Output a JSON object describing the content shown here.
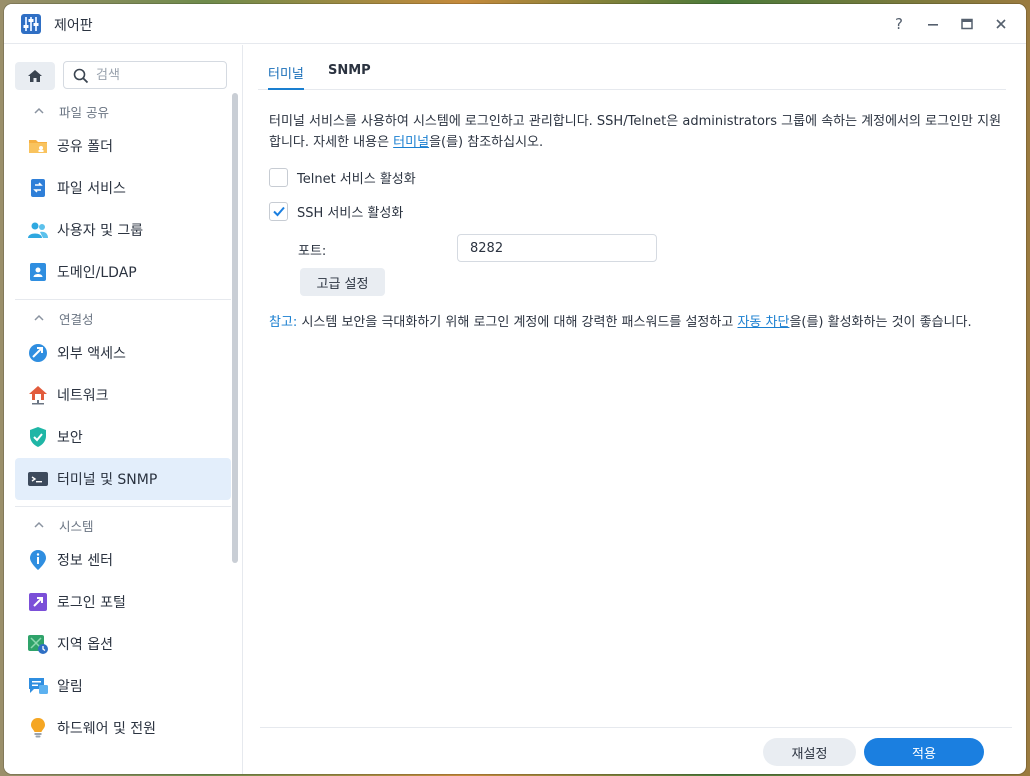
{
  "window": {
    "title": "제어판",
    "controls": {
      "help": "?",
      "minimize": "—",
      "maximize": "▭",
      "close": "✕"
    }
  },
  "sidebar": {
    "search_placeholder": "검색",
    "sections": [
      {
        "label": "파일 공유",
        "items": [
          {
            "label": "공유 폴더",
            "icon": "shared-folder-icon"
          },
          {
            "label": "파일 서비스",
            "icon": "file-services-icon"
          },
          {
            "label": "사용자 및 그룹",
            "icon": "users-groups-icon"
          },
          {
            "label": "도메인/LDAP",
            "icon": "domain-ldap-icon"
          }
        ]
      },
      {
        "label": "연결성",
        "items": [
          {
            "label": "외부 액세스",
            "icon": "external-access-icon"
          },
          {
            "label": "네트워크",
            "icon": "network-icon"
          },
          {
            "label": "보안",
            "icon": "security-shield-icon"
          },
          {
            "label": "터미널 및 SNMP",
            "icon": "terminal-icon",
            "active": true
          }
        ]
      },
      {
        "label": "시스템",
        "items": [
          {
            "label": "정보 센터",
            "icon": "info-center-icon"
          },
          {
            "label": "로그인 포털",
            "icon": "login-portal-icon"
          },
          {
            "label": "지역 옵션",
            "icon": "regional-options-icon"
          },
          {
            "label": "알림",
            "icon": "notification-icon"
          },
          {
            "label": "하드웨어 및 전원",
            "icon": "hardware-power-icon"
          }
        ]
      }
    ]
  },
  "tabs": [
    {
      "label": "터미널",
      "active": true
    },
    {
      "label": "SNMP",
      "active": false
    }
  ],
  "content": {
    "desc_before_link": "터미널 서비스를 사용하여 시스템에 로그인하고 관리합니다. SSH/Telnet은 administrators 그룹에 속하는 계정에서의 로그인만 지원합니다. 자세한 내용은 ",
    "desc_link": "터미널",
    "desc_after_link": "을(를) 참조하십시오.",
    "telnet_label": "Telnet 서비스 활성화",
    "telnet_checked": false,
    "ssh_label": "SSH 서비스 활성화",
    "ssh_checked": true,
    "port_label": "포트:",
    "port_value": "8282",
    "advanced_button": "고급 설정",
    "note_lead": "참고:",
    "note_before_link": " 시스템 보안을 극대화하기 위해 로그인 계정에 대해 강력한 패스워드를 설정하고 ",
    "note_link": "자동 차단",
    "note_after_link": "을(를) 활성화하는 것이 좋습니다."
  },
  "footer": {
    "reset_button": "재설정",
    "apply_button": "적용"
  },
  "colors": {
    "accent": "#1b7fe0",
    "link": "#1a7fd0",
    "active_bg": "#e3eefb"
  }
}
